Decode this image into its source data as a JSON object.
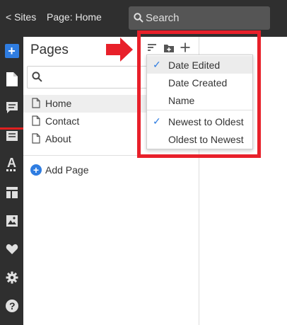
{
  "topbar": {
    "sites_label": "< Sites",
    "page_label": "Page: Home",
    "search_placeholder": "Search"
  },
  "panel": {
    "title": "Pages",
    "pages": [
      "Home",
      "Contact",
      "About"
    ],
    "add_page_label": "Add Page"
  },
  "sort_menu": {
    "items": [
      {
        "label": "Date Edited",
        "checked": true
      },
      {
        "label": "Date Created",
        "checked": false
      },
      {
        "label": "Name",
        "checked": false
      },
      {
        "label": "Newest to Oldest",
        "checked": true
      },
      {
        "label": "Oldest to Newest",
        "checked": false
      }
    ],
    "check_glyph": "✓"
  },
  "colors": {
    "accent": "#2f7de1",
    "annotation": "#e8202a",
    "dark_bar": "#2f2f2f"
  }
}
